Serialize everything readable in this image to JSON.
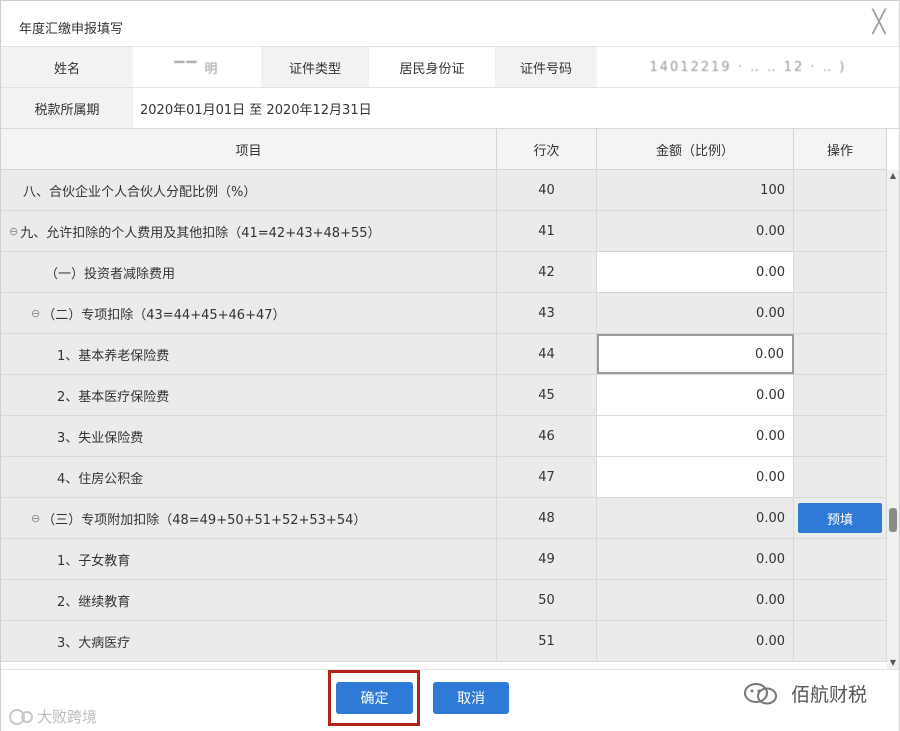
{
  "dialog": {
    "title": "年度汇缴申报填写",
    "close_glyph": "╳"
  },
  "info": {
    "name_label": "姓名",
    "name_value": "▔▔ 明",
    "cert_type_label": "证件类型",
    "cert_type_value": "居民身份证",
    "cert_no_label": "证件号码",
    "cert_no_value": "14012219 · ‥ ‥ 12 · ‥ )",
    "period_label": "税款所属期",
    "period_value": "2020年01月01日 至 2020年12月31日"
  },
  "table": {
    "headers": {
      "item": "项目",
      "line": "行次",
      "amount": "金额（比例）",
      "action": "操作"
    },
    "rows": [
      {
        "indent": 0,
        "expander": "",
        "item": "八、合伙企业个人合伙人分配比例（%）",
        "line": "40",
        "amount": "100",
        "editable": false,
        "action": ""
      },
      {
        "indent": 0,
        "expander": "⊖",
        "item": "九、允许扣除的个人费用及其他扣除（41=42+43+48+55）",
        "line": "41",
        "amount": "0.00",
        "editable": false,
        "action": ""
      },
      {
        "indent": 1,
        "expander": "",
        "item": "（一）投资者减除费用",
        "line": "42",
        "amount": "0.00",
        "editable": true,
        "action": ""
      },
      {
        "indent": 1,
        "expander": "⊖",
        "item": "（二）专项扣除（43=44+45+46+47）",
        "line": "43",
        "amount": "0.00",
        "editable": false,
        "action": ""
      },
      {
        "indent": 2,
        "expander": "",
        "item": "1、基本养老保险费",
        "line": "44",
        "amount": "0.00",
        "editable": true,
        "focused": true,
        "action": ""
      },
      {
        "indent": 2,
        "expander": "",
        "item": "2、基本医疗保险费",
        "line": "45",
        "amount": "0.00",
        "editable": true,
        "action": ""
      },
      {
        "indent": 2,
        "expander": "",
        "item": "3、失业保险费",
        "line": "46",
        "amount": "0.00",
        "editable": true,
        "action": ""
      },
      {
        "indent": 2,
        "expander": "",
        "item": "4、住房公积金",
        "line": "47",
        "amount": "0.00",
        "editable": true,
        "action": ""
      },
      {
        "indent": 1,
        "expander": "⊖",
        "item": "（三）专项附加扣除（48=49+50+51+52+53+54）",
        "line": "48",
        "amount": "0.00",
        "editable": false,
        "action": "预填"
      },
      {
        "indent": 2,
        "expander": "",
        "item": "1、子女教育",
        "line": "49",
        "amount": "0.00",
        "editable": false,
        "action": ""
      },
      {
        "indent": 2,
        "expander": "",
        "item": "2、继续教育",
        "line": "50",
        "amount": "0.00",
        "editable": false,
        "action": ""
      },
      {
        "indent": 2,
        "expander": "",
        "item": "3、大病医疗",
        "line": "51",
        "amount": "0.00",
        "editable": false,
        "action": ""
      }
    ]
  },
  "footer": {
    "ok_label": "确定",
    "cancel_label": "取消",
    "watermark_right": "佰航财税",
    "watermark_left": "大败跨境"
  },
  "colors": {
    "accent": "#2f7ad7",
    "highlight": "#b3231c",
    "row_bg": "#ebebeb"
  }
}
